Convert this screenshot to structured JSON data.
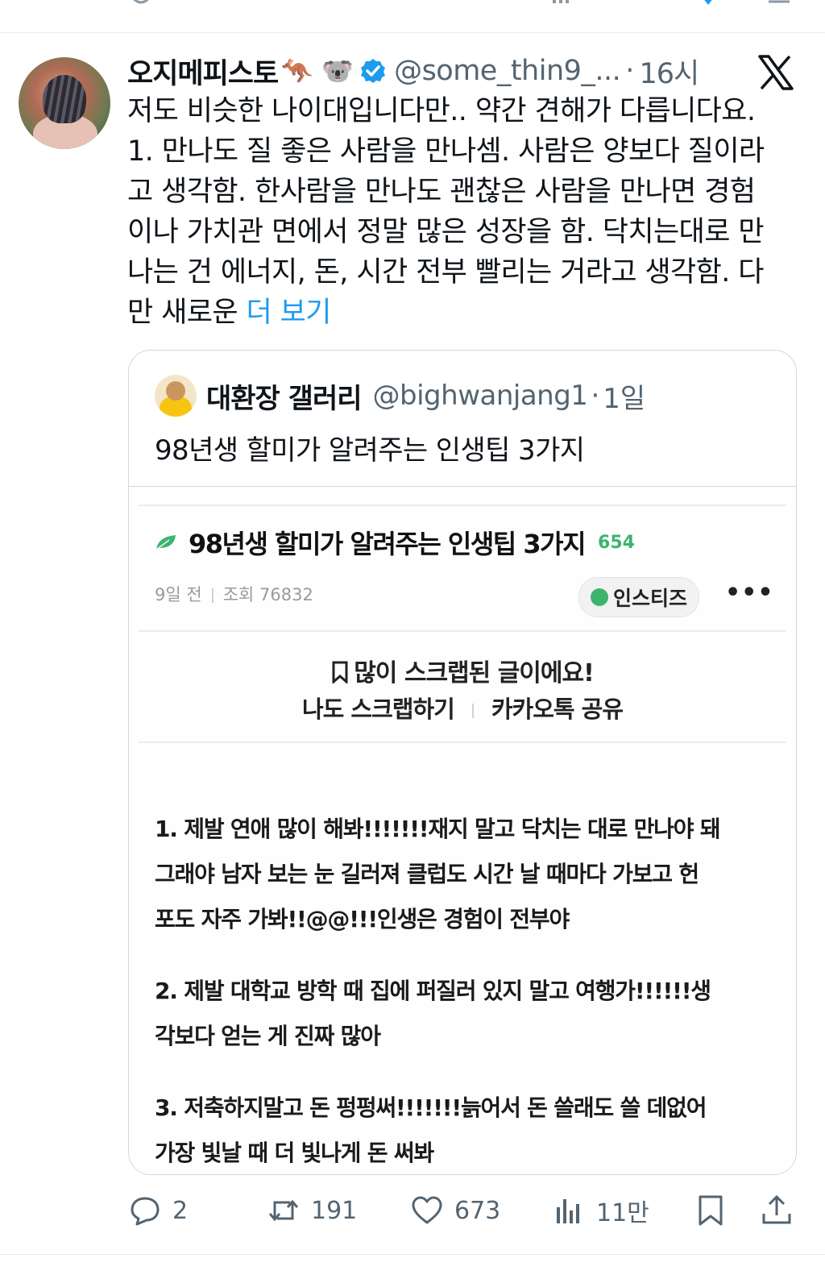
{
  "tweet": {
    "author_name": "오지메피스토",
    "author_emojis": "🦘 🐨",
    "handle": "@some_thin9_...",
    "separator": "·",
    "time": "16시",
    "text": "저도 비슷한 나이대입니다만.. 약간 견해가 다릅니다요.\n1. 만나도 질 좋은 사람을 만나셈. 사람은 양보다 질이라\n고 생각함. 한사람을 만나도 괜찮은 사람을 만나면 경험\n이나 가치관 면에서 정말 많은 성장을 함. 닥치는대로 만\n나는 건 에너지, 돈, 시간 전부 빨리는 거라고 생각함. 다\n만 새로운 ",
    "more_link": "더 보기"
  },
  "quote": {
    "author_name": "대환장 갤러리",
    "handle": "@bighwanjang1",
    "separator": "·",
    "time": "1일",
    "text": "98년생 할미가 알려주는 인생팁 3가지"
  },
  "screenshot": {
    "title": "98년생 할미가 알려주는 인생팁 3가지",
    "count": "654",
    "meta_age": "9일 전",
    "meta_views": "조회 76832",
    "chip_label": "인스티즈",
    "more_dots": "•••",
    "scrap_notice": "많이 스크랩된 글이에요!",
    "scrap_action": "나도 스크랩하기",
    "share_action": "카카오톡 공유",
    "tips": [
      "1. 제발 연애 많이 해봐!!!!!!!재지 말고 닥치는 대로 만나야 돼\n그래야 남자 보는 눈 길러져 클럽도 시간 날 때마다 가보고 헌\n포도 자주 가봐!!@@!!!인생은 경험이 전부야",
      "2. 제발 대학교 방학 때 집에 퍼질러 있지 말고 여행가!!!!!!생\n각보다 얻는 게 진짜 많아",
      "3. 저축하지말고 돈 펑펑써!!!!!!!늙어서 돈 쓸래도 쓸 데없어\n가장 빛날 때 더 빛나게 돈 써봐"
    ]
  },
  "actions": {
    "replies": "2",
    "retweets": "191",
    "likes": "673",
    "views": "11만"
  },
  "colors": {
    "link": "#1d9bf0",
    "secondary_text": "#536471",
    "verified": "#1d9bf0",
    "accent_green": "#3cb46e"
  }
}
